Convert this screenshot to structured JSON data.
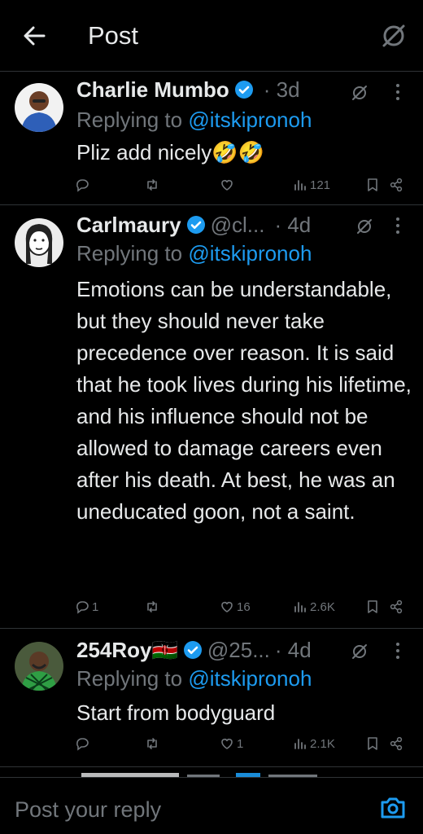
{
  "header": {
    "title": "Post"
  },
  "tweets": [
    {
      "name": "Charlie Mumbo",
      "handle": "",
      "time": "· 3d",
      "replying_prefix": "Replying to ",
      "replying_to": "@itskipronoh",
      "text": "Pliz add nicely🤣🤣",
      "replies": "",
      "likes": "",
      "views": "121"
    },
    {
      "name": "Carlmaury",
      "handle": "@cl...",
      "time": "· 4d",
      "replying_prefix": "Replying to ",
      "replying_to": "@itskipronoh",
      "text": "Emotions can be understandable, but they should never take precedence over reason. It is said that he took lives during his lifetime, and his influence should not be allowed to damage careers even after his death. At best, he was an uneducated goon, not a saint.",
      "replies": "1",
      "likes": "16",
      "views": "2.6K"
    },
    {
      "name": "254Roy🇰🇪",
      "handle": "@25...",
      "time": "· 4d",
      "replying_prefix": "Replying to ",
      "replying_to": "@itskipronoh",
      "text": "Start from bodyguard",
      "replies": "",
      "likes": "1",
      "views": "2.1K"
    }
  ],
  "composer": {
    "placeholder": "Post your reply"
  },
  "colors": {
    "accent": "#1d9bf0",
    "muted": "#71767b",
    "text": "#e7e9ea",
    "background": "#000000"
  }
}
